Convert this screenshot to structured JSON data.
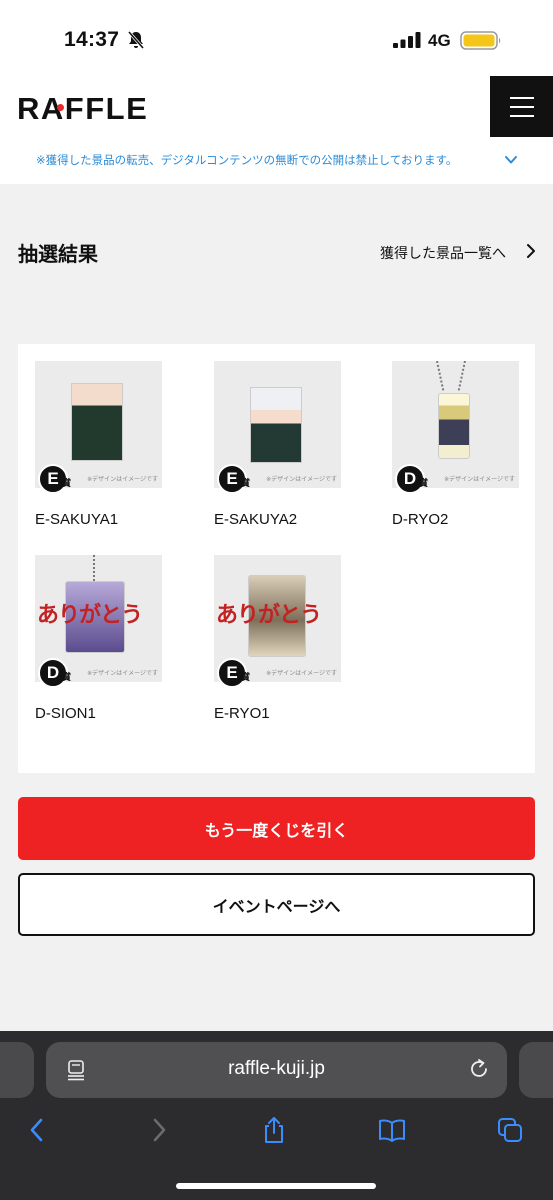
{
  "status_bar": {
    "time": "14:37",
    "network": "4G"
  },
  "header": {
    "logo": "RAFFLE"
  },
  "notice": {
    "text": "※獲得した景品の転売、デジタルコンテンツの無断での公開は禁止しております。"
  },
  "section": {
    "title": "抽選結果",
    "prize_list_link": "獲得した景品一覧へ"
  },
  "items": [
    {
      "label": "E-SAKUYA1",
      "grade": "E",
      "grade_suffix": "賞",
      "note": "※デザインはイメージです"
    },
    {
      "label": "E-SAKUYA2",
      "grade": "E",
      "grade_suffix": "賞",
      "note": "※デザインはイメージです"
    },
    {
      "label": "D-RYO2",
      "grade": "D",
      "grade_suffix": "賞",
      "note": "※デザインはイメージです"
    },
    {
      "label": "D-SION1",
      "grade": "D",
      "grade_suffix": "賞",
      "note": "※デザインはイメージです",
      "art_text": "ありがとう"
    },
    {
      "label": "E-RYO1",
      "grade": "E",
      "grade_suffix": "賞",
      "note": "※デザインはイメージです",
      "art_text": "ありがとう"
    }
  ],
  "buttons": {
    "draw_again": "もう一度くじを引く",
    "event_page": "イベントページへ"
  },
  "browser": {
    "url": "raffle-kuji.jp"
  },
  "colors": {
    "accent_red": "#ee2222",
    "notice_blue": "#2c8bd6",
    "battery_yellow": "#f5c518"
  }
}
